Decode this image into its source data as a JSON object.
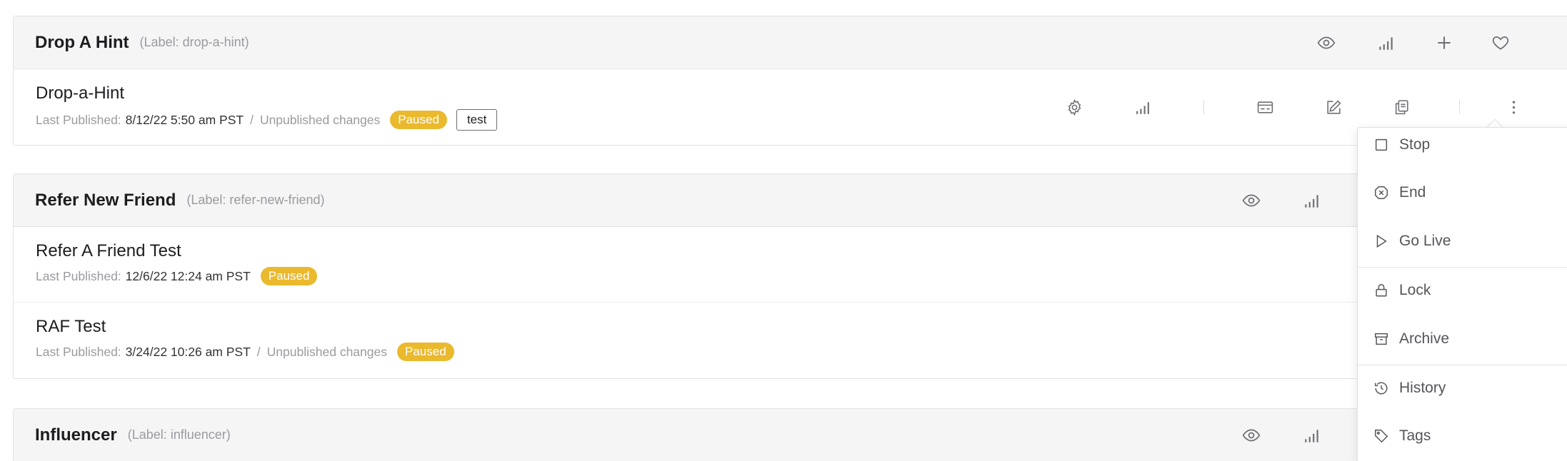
{
  "groups": [
    {
      "title": "Drop A Hint",
      "label": "(Label: drop-a-hint)",
      "items": [
        {
          "name": "Drop-a-Hint",
          "published_prefix": "Last Published:",
          "published_date": "8/12/22 5:50 am PST",
          "separator": "/",
          "unpublished": "Unpublished changes",
          "status": "Paused",
          "tag": "test"
        }
      ]
    },
    {
      "title": "Refer New Friend",
      "label": "(Label: refer-new-friend)",
      "items": [
        {
          "name": "Refer A Friend Test",
          "published_prefix": "Last Published:",
          "published_date": "12/6/22 12:24 am PST",
          "status": "Paused"
        },
        {
          "name": "RAF Test",
          "published_prefix": "Last Published:",
          "published_date": "3/24/22 10:26 am PST",
          "separator": "/",
          "unpublished": "Unpublished changes",
          "status": "Paused"
        }
      ]
    },
    {
      "title": "Influencer",
      "label": "(Label: influencer)",
      "items": []
    }
  ],
  "icons": {
    "group_actions": [
      "eye-icon",
      "signal-bars-icon",
      "plus-icon",
      "heart-icon"
    ],
    "row_actions": [
      "gear-icon",
      "signal-bars-icon",
      "card-icon",
      "edit-icon",
      "copy-icon",
      "more-vertical-icon"
    ]
  },
  "menu": {
    "items": [
      {
        "label": "Stop",
        "icon": "stop-square-icon"
      },
      {
        "label": "End",
        "icon": "x-octagon-icon"
      },
      {
        "label": "Go Live",
        "icon": "play-icon"
      },
      {
        "label": "Lock",
        "icon": "lock-icon"
      },
      {
        "label": "Archive",
        "icon": "archive-icon"
      },
      {
        "label": "History",
        "icon": "history-icon"
      },
      {
        "label": "Tags",
        "icon": "tag-icon"
      }
    ]
  },
  "colors": {
    "paused_badge": "#eab92d",
    "header_bg": "#f5f5f6",
    "icon": "#6e6e73"
  }
}
